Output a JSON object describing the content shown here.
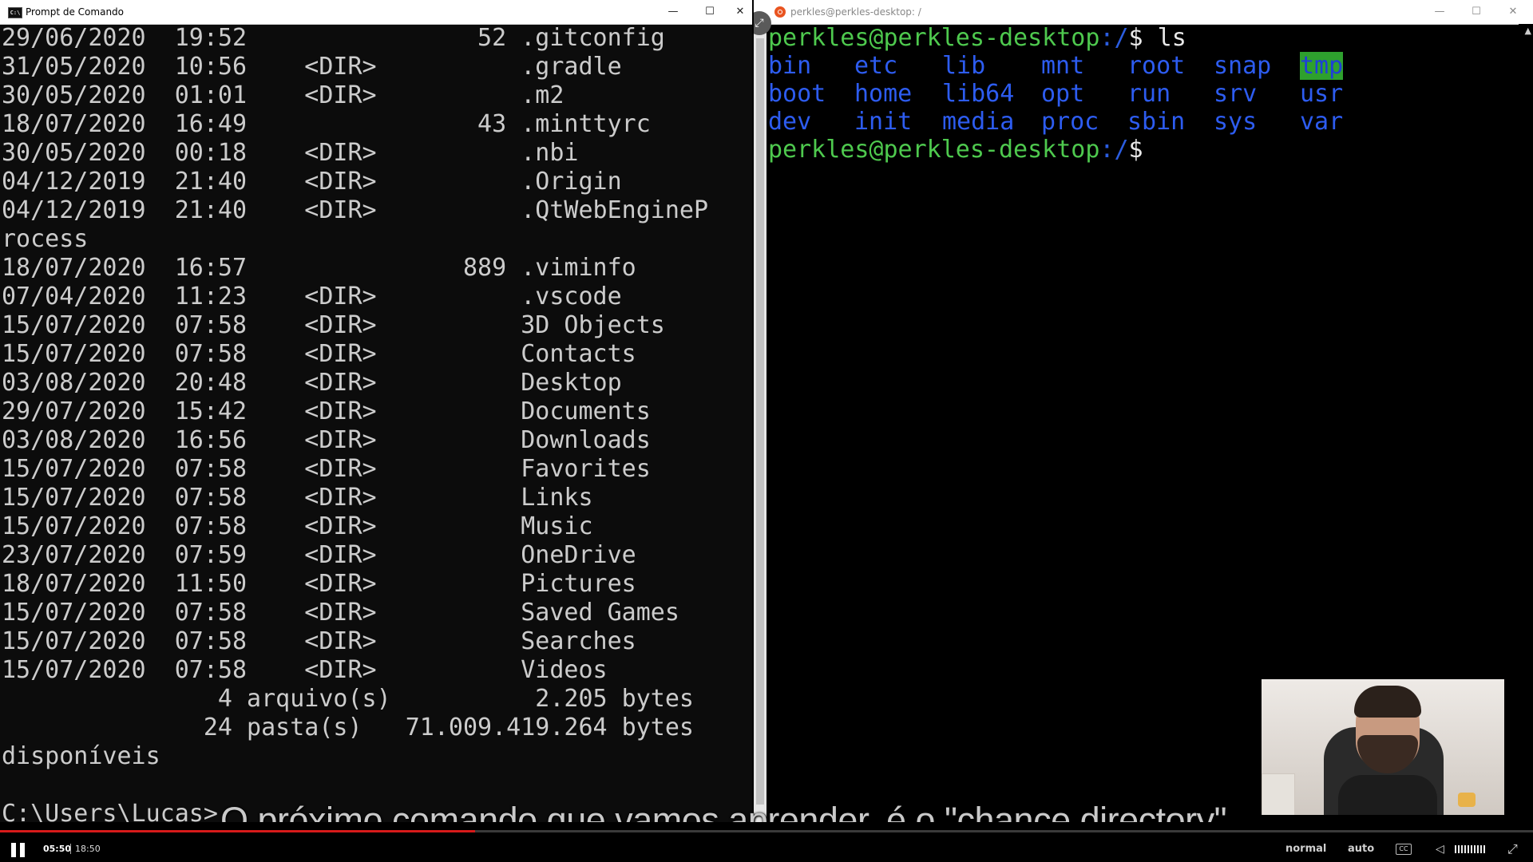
{
  "cmd": {
    "title": "Prompt de Comando",
    "icon_text": "C:\\",
    "window_controls": [
      "—",
      "☐",
      "✕"
    ],
    "lines": [
      "29/06/2020  19:52                52 .gitconfig",
      "31/05/2020  10:56    <DIR>          .gradle",
      "30/05/2020  01:01    <DIR>          .m2",
      "18/07/2020  16:49                43 .minttyrc",
      "30/05/2020  00:18    <DIR>          .nbi",
      "04/12/2019  21:40    <DIR>          .Origin",
      "04/12/2019  21:40    <DIR>          .QtWebEngineP",
      "rocess",
      "18/07/2020  16:57               889 .viminfo",
      "07/04/2020  11:23    <DIR>          .vscode",
      "15/07/2020  07:58    <DIR>          3D Objects",
      "15/07/2020  07:58    <DIR>          Contacts",
      "03/08/2020  20:48    <DIR>          Desktop",
      "29/07/2020  15:42    <DIR>          Documents",
      "03/08/2020  16:56    <DIR>          Downloads",
      "15/07/2020  07:58    <DIR>          Favorites",
      "15/07/2020  07:58    <DIR>          Links",
      "15/07/2020  07:58    <DIR>          Music",
      "23/07/2020  07:59    <DIR>          OneDrive",
      "18/07/2020  11:50    <DIR>          Pictures",
      "15/07/2020  07:58    <DIR>          Saved Games",
      "15/07/2020  07:58    <DIR>          Searches",
      "15/07/2020  07:58    <DIR>          Videos",
      "               4 arquivo(s)          2.205 bytes",
      "              24 pasta(s)   71.009.419.264 bytes",
      "disponíveis",
      "",
      "C:\\Users\\Lucas>"
    ]
  },
  "terminal": {
    "title": "perkles@perkles-desktop: /",
    "window_controls": [
      "—",
      "☐",
      "✕"
    ],
    "prompt_user": "perkles@perkles-desktop",
    "prompt_path": ":/",
    "prompt_symbol": "$",
    "command": " ls",
    "ls_rows": [
      [
        "bin",
        "etc",
        "lib",
        "mnt",
        "root",
        "snap",
        "tmp"
      ],
      [
        "boot",
        "home",
        "lib64",
        "opt",
        "run",
        "srv",
        "usr"
      ],
      [
        "dev",
        "init",
        "media",
        "proc",
        "sbin",
        "sys",
        "var"
      ]
    ],
    "highlighted_item": "tmp",
    "colors": {
      "prompt": "#4ec94e",
      "path": "#2b5de0",
      "dirs": "#2d5cf0",
      "highlight_bg": "#2ea02e"
    }
  },
  "subtitle": "O próximo comando que vamos aprender, é o \"chance directory\",",
  "player": {
    "current_time": "05:50",
    "total_time": "18:50",
    "progress": 0.31,
    "speed_label": "normal",
    "quality_label": "auto",
    "cc_label": "CC",
    "progress_color": "#d71a1a"
  }
}
